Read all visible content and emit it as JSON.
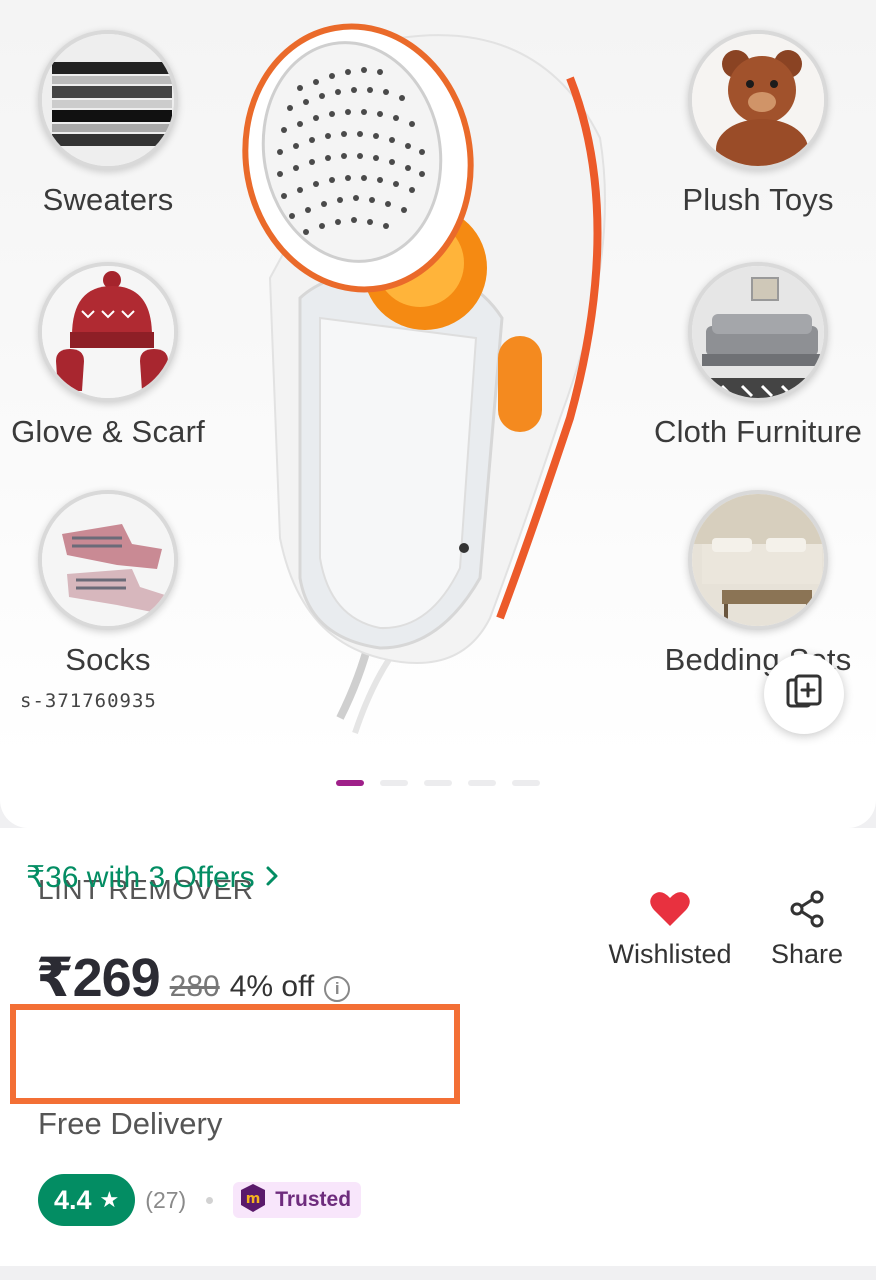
{
  "gallery": {
    "categories_left": [
      "Sweaters",
      "Glove & Scarf",
      "Socks"
    ],
    "categories_right": [
      "Plush Toys",
      "Cloth Furniture",
      "Bedding Sets"
    ],
    "watermark": "s-371760935",
    "zoom_icon": "gallery-expand-icon",
    "dot_count": 5,
    "active_dot": 0
  },
  "product": {
    "title": "LINT REMOVER",
    "price": "₹269",
    "mrp": "280",
    "discount": "4% off",
    "info_icon": "i",
    "offer_text": "₹36 with 3 Offers",
    "delivery": "Free Delivery",
    "rating": "4.4",
    "rating_star": "★",
    "rating_count": "(27)",
    "trusted_label": "Trusted",
    "trusted_logo": "m"
  },
  "actions": {
    "wishlist_label": "Wishlisted",
    "share_label": "Share"
  },
  "colors": {
    "brand": "#9f2089",
    "green": "#038d63",
    "offer_border": "#f36f35",
    "heart": "#e8313f"
  }
}
